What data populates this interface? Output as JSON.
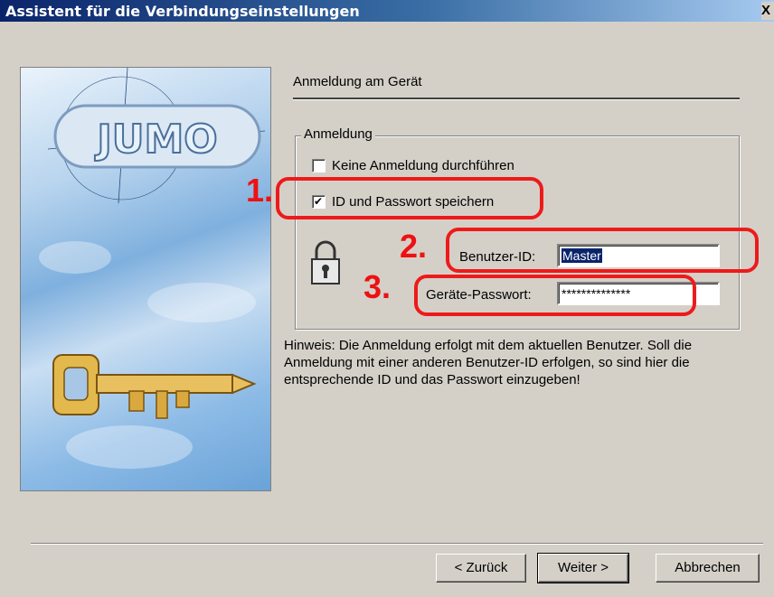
{
  "window": {
    "title": "Assistent für die Verbindungseinstellungen",
    "close_glyph": "X"
  },
  "page": {
    "header": "Anmeldung am Gerät"
  },
  "login_group": {
    "title": "Anmeldung",
    "no_login": {
      "label": "Keine Anmeldung durchführen",
      "checked": false
    },
    "save_credentials": {
      "label": "ID und Passwort speichern",
      "checked": true
    },
    "user_id": {
      "label": "Benutzer-ID:",
      "value": "Master"
    },
    "password": {
      "label": "Geräte-Passwort:",
      "value": "**************"
    }
  },
  "hint": "Hinweis: Die Anmeldung erfolgt mit dem aktuellen Benutzer. Soll die Anmeldung mit einer anderen Benutzer-ID erfolgen, so sind hier die entsprechende ID und das Passwort einzugeben!",
  "annotations": {
    "m1": "1.",
    "m2": "2.",
    "m3": "3.",
    "color": "#ee1a1a"
  },
  "art": {
    "logo_text": "JUMO"
  },
  "buttons": {
    "back": "< Zurück",
    "next": "Weiter >",
    "cancel": "Abbrechen"
  },
  "icons": {
    "lock": "padlock-icon",
    "key": "key-icon"
  }
}
